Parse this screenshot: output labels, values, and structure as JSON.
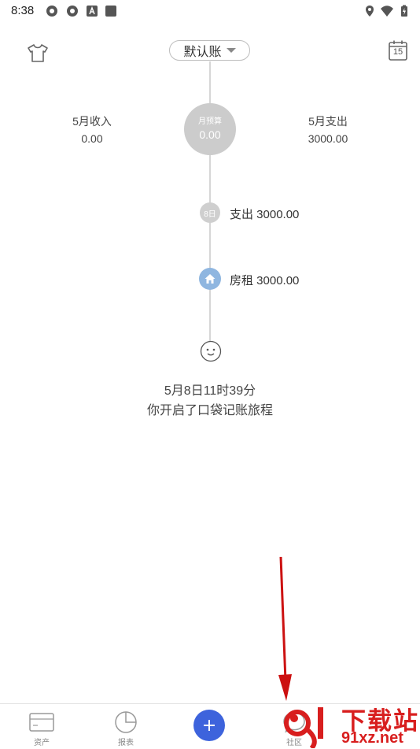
{
  "status_bar": {
    "time": "8:38"
  },
  "header": {
    "book_name": "默认账",
    "calendar_day": "15"
  },
  "summary": {
    "income_label": "5月收入",
    "income_value": "0.00",
    "budget_label": "月预算",
    "budget_value": "0.00",
    "expense_label": "5月支出",
    "expense_value": "3000.00"
  },
  "timeline": {
    "day_badge": "8日",
    "day_total": "支出 3000.00",
    "entry": "房租 3000.00",
    "start_line1": "5月8日11时39分",
    "start_line2": "你开启了口袋记账旅程"
  },
  "bottom_nav": {
    "assets": "资产",
    "reports": "报表",
    "community": "社区"
  },
  "watermark": {
    "line1": "下载站",
    "line2": "91xz.net"
  },
  "colors": {
    "fab": "#3d63dc",
    "category_badge": "#8fb6e0",
    "arrow": "#cc1111",
    "watermark": "#d81e1e"
  }
}
